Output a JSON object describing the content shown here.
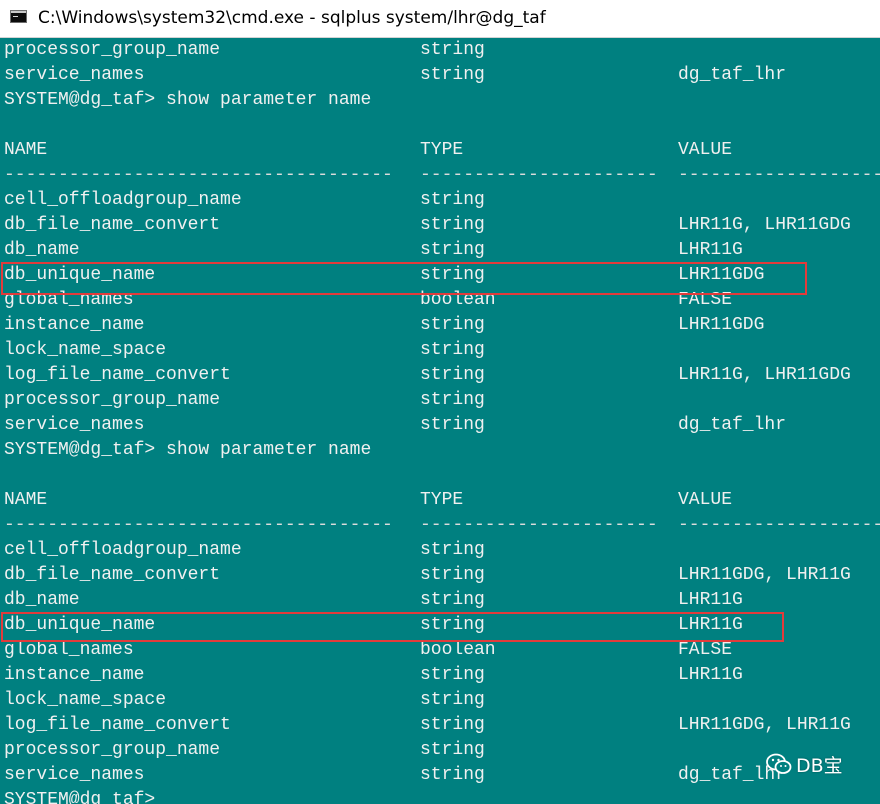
{
  "window": {
    "title": "C:\\Windows\\system32\\cmd.exe - sqlplus  system/lhr@dg_taf"
  },
  "console": {
    "top_rows": [
      {
        "name": "processor_group_name",
        "type": "string",
        "value": ""
      },
      {
        "name": "service_names",
        "type": "string",
        "value": "dg_taf_lhr"
      }
    ],
    "blocks": [
      {
        "prompt": "SYSTEM@dg_taf> show parameter name",
        "header": {
          "name": "NAME",
          "type": "TYPE",
          "value": "VALUE"
        },
        "rule": {
          "name": "------------------------------------",
          "type": "----------------------",
          "value": "------------------------------"
        },
        "rows": [
          {
            "name": "cell_offloadgroup_name",
            "type": "string",
            "value": ""
          },
          {
            "name": "db_file_name_convert",
            "type": "string",
            "value": "LHR11G, LHR11GDG"
          },
          {
            "name": "db_name",
            "type": "string",
            "value": "LHR11G"
          },
          {
            "name": "db_unique_name",
            "type": "string",
            "value": "LHR11GDG"
          },
          {
            "name": "global_names",
            "type": "boolean",
            "value": "FALSE"
          },
          {
            "name": "instance_name",
            "type": "string",
            "value": "LHR11GDG"
          },
          {
            "name": "lock_name_space",
            "type": "string",
            "value": ""
          },
          {
            "name": "log_file_name_convert",
            "type": "string",
            "value": "LHR11G, LHR11GDG"
          },
          {
            "name": "processor_group_name",
            "type": "string",
            "value": ""
          },
          {
            "name": "service_names",
            "type": "string",
            "value": "dg_taf_lhr"
          }
        ]
      },
      {
        "prompt": "SYSTEM@dg_taf> show parameter name",
        "header": {
          "name": "NAME",
          "type": "TYPE",
          "value": "VALUE"
        },
        "rule": {
          "name": "------------------------------------",
          "type": "----------------------",
          "value": "------------------------------"
        },
        "rows": [
          {
            "name": "cell_offloadgroup_name",
            "type": "string",
            "value": ""
          },
          {
            "name": "db_file_name_convert",
            "type": "string",
            "value": "LHR11GDG, LHR11G"
          },
          {
            "name": "db_name",
            "type": "string",
            "value": "LHR11G"
          },
          {
            "name": "db_unique_name",
            "type": "string",
            "value": "LHR11G"
          },
          {
            "name": "global_names",
            "type": "boolean",
            "value": "FALSE"
          },
          {
            "name": "instance_name",
            "type": "string",
            "value": "LHR11G"
          },
          {
            "name": "lock_name_space",
            "type": "string",
            "value": ""
          },
          {
            "name": "log_file_name_convert",
            "type": "string",
            "value": "LHR11GDG, LHR11G"
          },
          {
            "name": "processor_group_name",
            "type": "string",
            "value": ""
          },
          {
            "name": "service_names",
            "type": "string",
            "value": "dg_taf_lhr"
          }
        ]
      }
    ],
    "final_prompt": "SYSTEM@dg_taf>"
  },
  "watermark": {
    "text": "DB宝",
    "icon": "wechat-icon"
  },
  "colors": {
    "console_bg": "#008080",
    "console_text": "#f0f0f0",
    "highlight": "#e23b3b"
  }
}
